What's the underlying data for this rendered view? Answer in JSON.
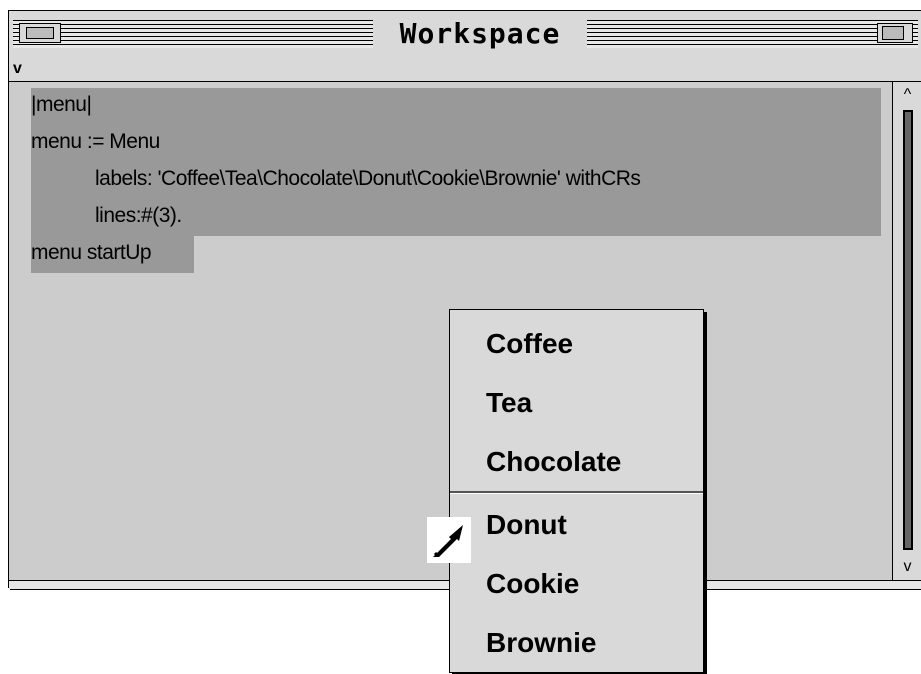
{
  "window": {
    "title": "Workspace",
    "menu_indicator": "v"
  },
  "code": {
    "lines": [
      "|menu|",
      "menu := Menu",
      "labels: 'Coffee\\Tea\\Chocolate\\Donut\\Cookie\\Brownie' withCRs",
      "lines:#(3).",
      "menu startUp"
    ]
  },
  "scrollbar": {
    "up_glyph": "^",
    "down_glyph": "v"
  },
  "popup_menu": {
    "items": [
      "Coffee",
      "Tea",
      "Chocolate",
      "Donut",
      "Cookie",
      "Brownie"
    ]
  },
  "icons": {
    "close": "close-box-icon",
    "zoom": "zoom-box-icon",
    "cursor": "arrow-cursor-icon"
  },
  "colors": {
    "window_bg": "#cccccc",
    "selection": "#999999",
    "text": "#000000"
  }
}
